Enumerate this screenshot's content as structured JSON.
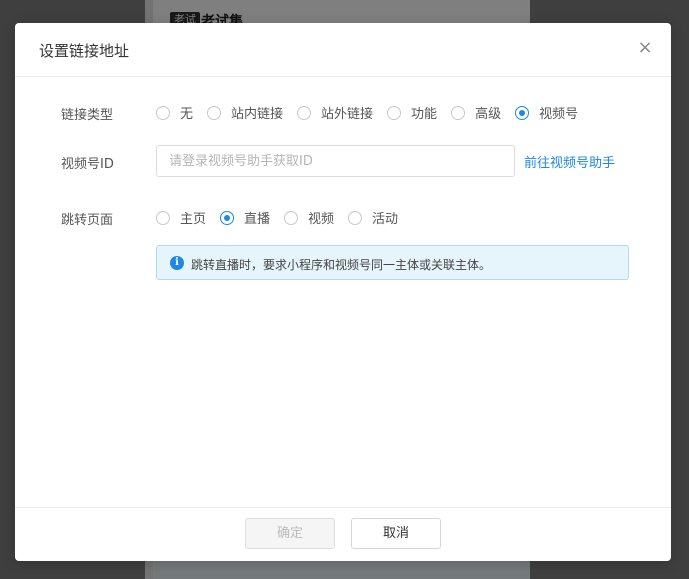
{
  "background": {
    "tag": "老试",
    "title": "老试集"
  },
  "dialog": {
    "title": "设置链接地址",
    "close_icon": "×"
  },
  "link_type": {
    "label": "链接类型",
    "options": [
      "无",
      "站内链接",
      "站外链接",
      "功能",
      "高级",
      "视频号"
    ],
    "selected": "视频号"
  },
  "channel_id": {
    "label": "视频号ID",
    "value": "",
    "placeholder": "请登录视频号助手获取ID",
    "link": "前往视频号助手"
  },
  "jump_page": {
    "label": "跳转页面",
    "options": [
      "主页",
      "直播",
      "视频",
      "活动"
    ],
    "selected": "直播"
  },
  "info": {
    "icon": "info-icon",
    "icon_glyph": "i",
    "text": "跳转直播时，要求小程序和视频号同一主体或关联主体。"
  },
  "footer": {
    "ok_label": "确定",
    "cancel_label": "取消"
  },
  "colors": {
    "accent": "#1e88e5",
    "info_bg": "#e6f5fc",
    "info_border": "#a9dcf5"
  }
}
